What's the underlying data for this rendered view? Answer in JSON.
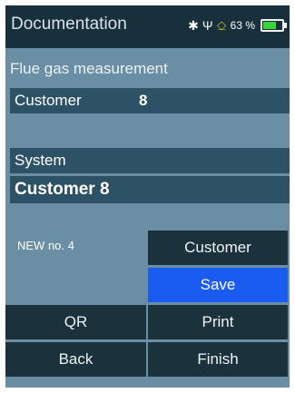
{
  "header": {
    "title": "Documentation",
    "battery_percent": "63 %",
    "icons": [
      "bluetooth-icon",
      "usb-icon",
      "plug-icon",
      "battery-icon"
    ],
    "battery_level": 0.63
  },
  "screen": {
    "subtitle": "Flue gas measurement",
    "customer_label": "Customer",
    "customer_value": "8",
    "system_label": "System",
    "system_value": "Customer 8",
    "new_no": "NEW no. 4"
  },
  "buttons": {
    "customer": "Customer",
    "save": "Save",
    "qr": "QR",
    "print": "Print",
    "back": "Back",
    "finish": "Finish"
  },
  "colors": {
    "header_bg": "#18303b",
    "screen_bg": "#6a8ea3",
    "row_bg": "#2d5266",
    "button_bg": "#1b323d",
    "primary_button": "#1a5cf2",
    "battery_fill": "#37d43b"
  }
}
